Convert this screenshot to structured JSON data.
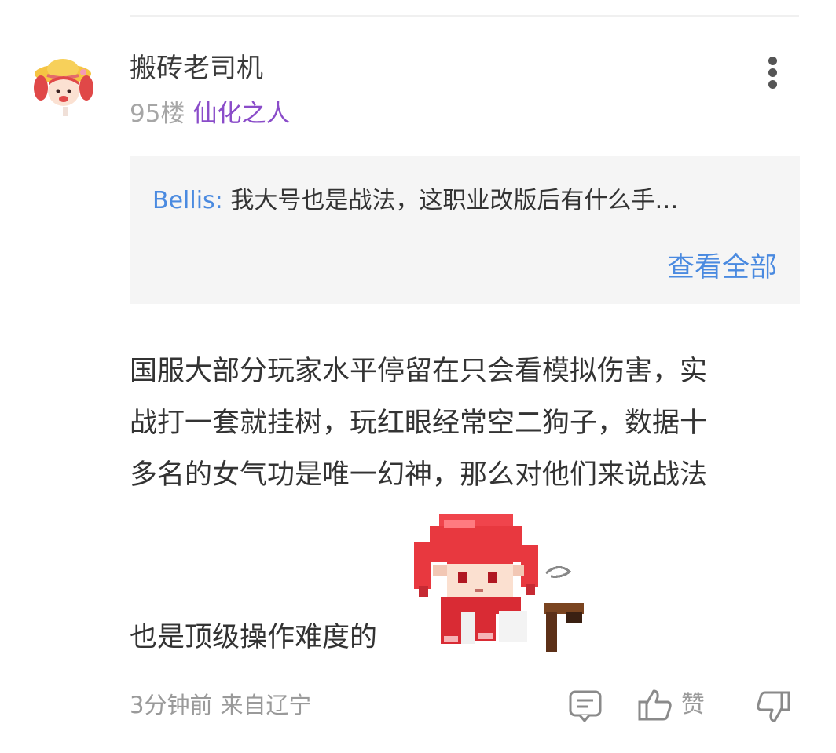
{
  "comment": {
    "username": "搬砖老司机",
    "floor": "95楼",
    "flair": "仙化之人",
    "quote": {
      "author": "Bellis:",
      "text": "我大号也是战法，这职业改版后有什么手…",
      "view_all_label": "查看全部"
    },
    "body_lines": [
      "国服大部分玩家水平停留在只会看模拟伤害，实",
      "战打一套就挂树，玩红眼经常空二狗子，数据十",
      "多名的女气功是唯一幻神，那么对他们来说战法"
    ],
    "body_last_line": "也是顶级操作难度的",
    "time": "3分钟前",
    "location": "来自辽宁",
    "like_label": "赞"
  },
  "icons": {
    "avatar": "avatar-girl-straw-hat",
    "more": "more-vertical-icon",
    "sticker": "pixel-girl-red-scarf-sticker",
    "reply": "reply-comment-icon",
    "like": "thumbs-up-icon",
    "dislike": "thumbs-down-icon"
  },
  "colors": {
    "link_blue": "#4a8ae0",
    "flair_purple": "#8a4cc9",
    "muted_gray": "#9a9a9a",
    "quote_bg": "#f5f5f5"
  }
}
